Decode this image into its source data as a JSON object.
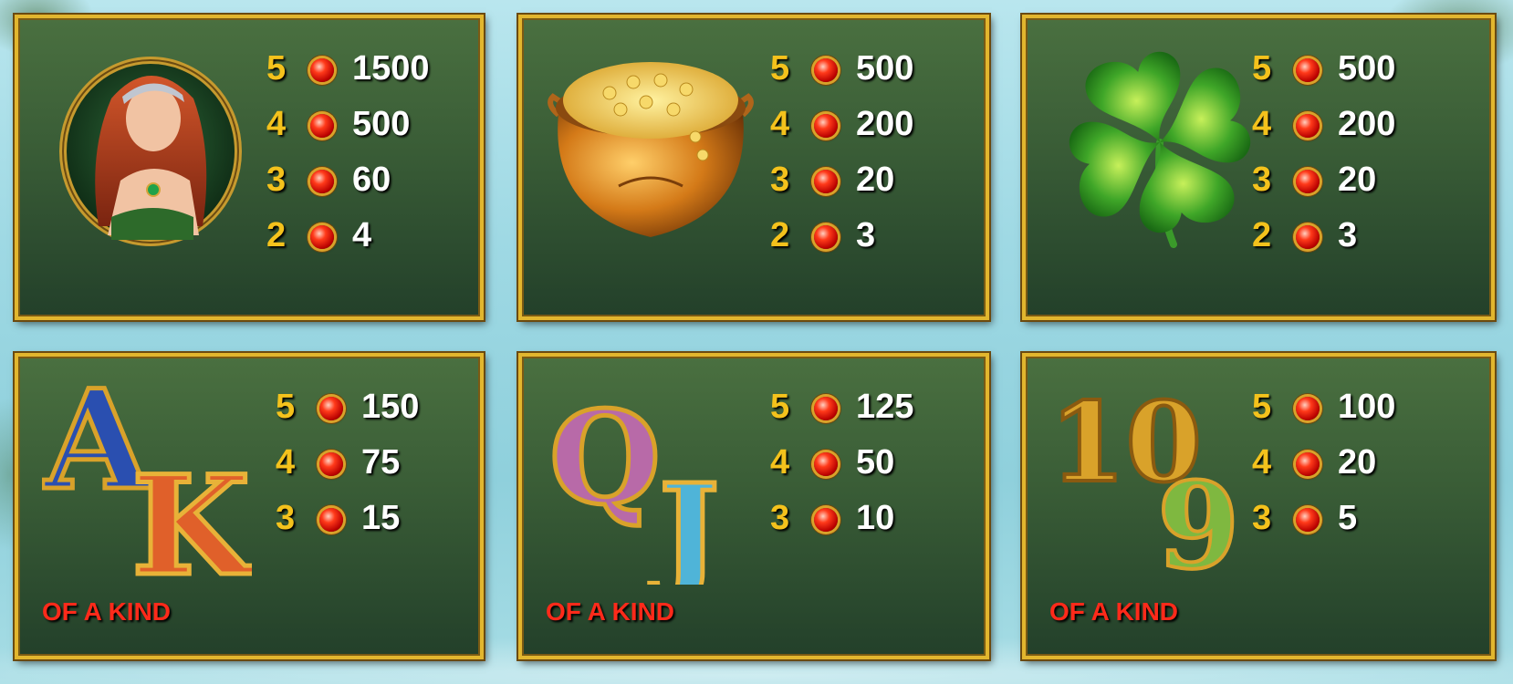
{
  "panels": [
    {
      "symbol": "redhead-lady-icon",
      "pays": [
        {
          "count": "5",
          "value": "1500"
        },
        {
          "count": "4",
          "value": "500"
        },
        {
          "count": "3",
          "value": "60"
        },
        {
          "count": "2",
          "value": "4"
        }
      ]
    },
    {
      "symbol": "pot-of-gold-icon",
      "pays": [
        {
          "count": "5",
          "value": "500"
        },
        {
          "count": "4",
          "value": "200"
        },
        {
          "count": "3",
          "value": "20"
        },
        {
          "count": "2",
          "value": "3"
        }
      ]
    },
    {
      "symbol": "four-leaf-clover-icon",
      "pays": [
        {
          "count": "5",
          "value": "500"
        },
        {
          "count": "4",
          "value": "200"
        },
        {
          "count": "3",
          "value": "20"
        },
        {
          "count": "2",
          "value": "3"
        }
      ]
    },
    {
      "symbol": "ace-king-icon",
      "pays": [
        {
          "count": "5",
          "value": "150"
        },
        {
          "count": "4",
          "value": "75"
        },
        {
          "count": "3",
          "value": "15"
        }
      ],
      "caption": "OF A KIND"
    },
    {
      "symbol": "queen-jack-icon",
      "pays": [
        {
          "count": "5",
          "value": "125"
        },
        {
          "count": "4",
          "value": "50"
        },
        {
          "count": "3",
          "value": "10"
        }
      ],
      "caption": "OF A KIND"
    },
    {
      "symbol": "ten-nine-icon",
      "pays": [
        {
          "count": "5",
          "value": "100"
        },
        {
          "count": "4",
          "value": "20"
        },
        {
          "count": "3",
          "value": "5"
        }
      ],
      "caption": "OF A KIND"
    }
  ],
  "colors": {
    "frame": "#e2b62e",
    "count": "#f4c21c",
    "value": "#ffffff",
    "caption": "#ff2a1a"
  }
}
